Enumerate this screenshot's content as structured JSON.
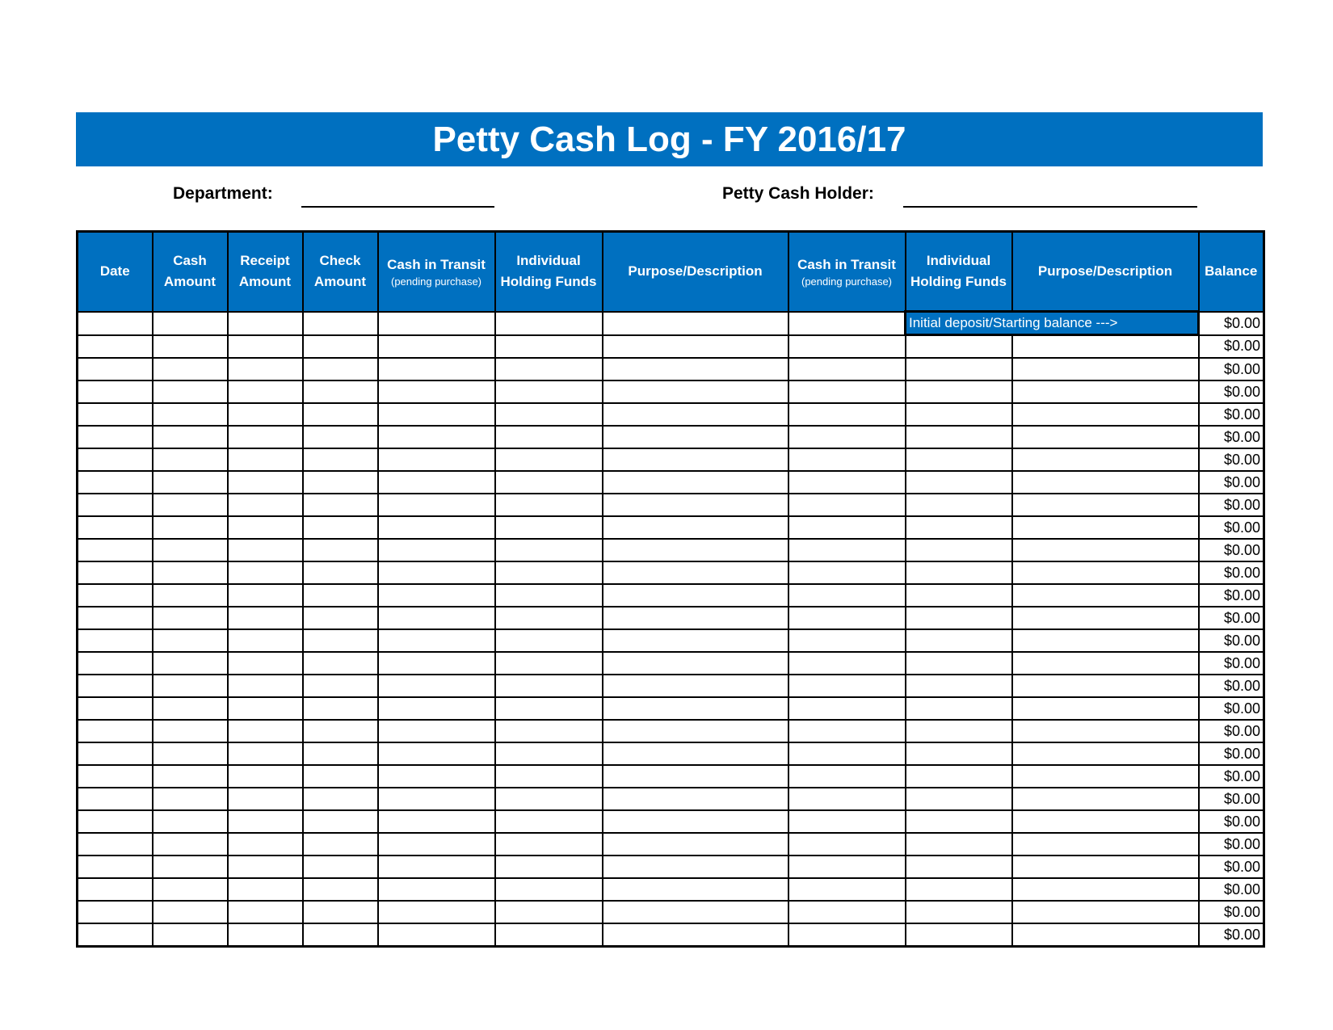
{
  "title": "Petty Cash Log - FY 2016/17",
  "department_label": "Department:",
  "holder_label": "Petty Cash Holder:",
  "columns": [
    {
      "label": "Date",
      "sub": ""
    },
    {
      "label": "Cash Amount",
      "sub": ""
    },
    {
      "label": "Receipt Amount",
      "sub": ""
    },
    {
      "label": "Check Amount",
      "sub": ""
    },
    {
      "label": "Cash in Transit",
      "sub": "(pending purchase)"
    },
    {
      "label": "Individual Holding Funds",
      "sub": ""
    },
    {
      "label": "Purpose/Description",
      "sub": ""
    },
    {
      "label": "Cash in Transit",
      "sub": "(pending purchase)"
    },
    {
      "label": "Individual Holding Funds",
      "sub": ""
    },
    {
      "label": "Purpose/Description",
      "sub": ""
    },
    {
      "label": "Balance",
      "sub": ""
    }
  ],
  "initial_label": "Initial deposit/Starting balance  --->",
  "balances": [
    "$0.00",
    "$0.00",
    "$0.00",
    "$0.00",
    "$0.00",
    "$0.00",
    "$0.00",
    "$0.00",
    "$0.00",
    "$0.00",
    "$0.00",
    "$0.00",
    "$0.00",
    "$0.00",
    "$0.00",
    "$0.00",
    "$0.00",
    "$0.00",
    "$0.00",
    "$0.00",
    "$0.00",
    "$0.00",
    "$0.00",
    "$0.00",
    "$0.00",
    "$0.00",
    "$0.00",
    "$0.00"
  ],
  "colors": {
    "header_blue": "#0070c0"
  }
}
